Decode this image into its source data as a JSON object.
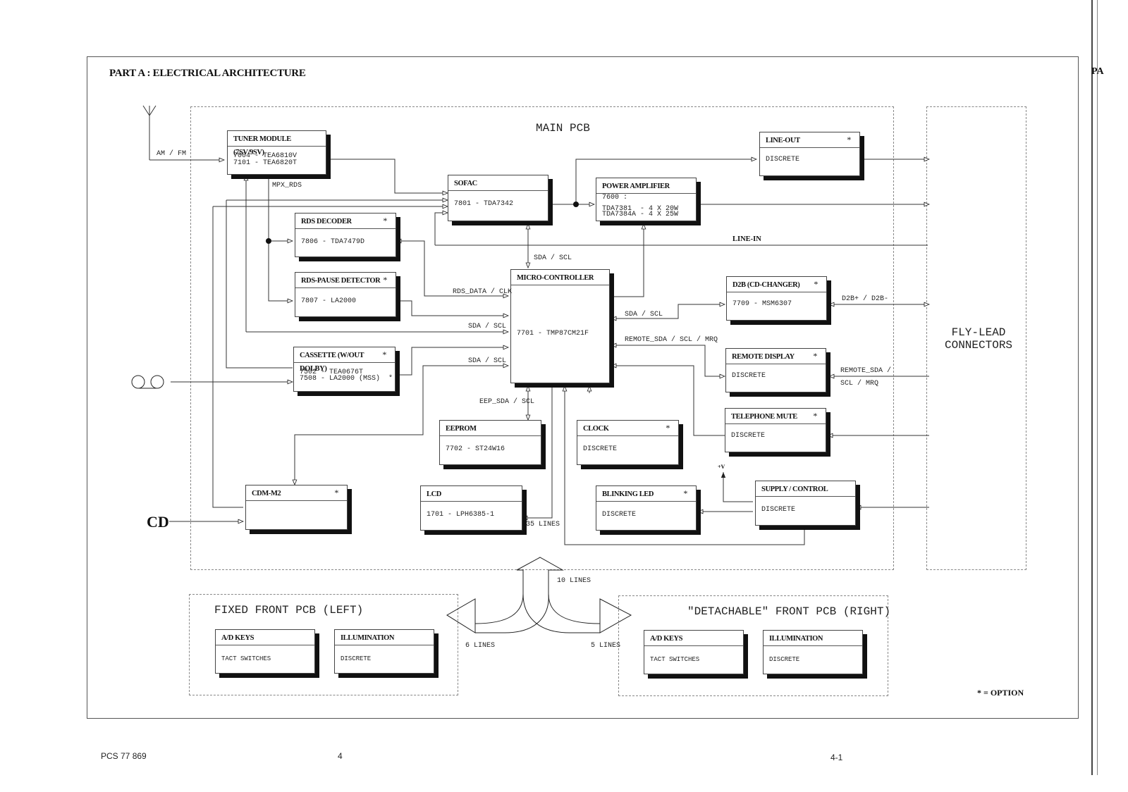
{
  "page": {
    "title": "PART A : ELECTRICAL ARCHITECTURE",
    "edge_label": "PA",
    "option_note": "* = OPTION",
    "footer": {
      "doc_id": "PCS 77 869",
      "page_num": "4",
      "section": "4-1"
    }
  },
  "regions": {
    "main_pcb": "MAIN PCB",
    "fly_lead": "FLY-LEAD\nCONNECTORS",
    "front_left": "FIXED FRONT PCB (LEFT)",
    "front_right": "\"DETACHABLE\" FRONT PCB (RIGHT)"
  },
  "blocks": {
    "tuner": {
      "title": "TUNER MODULE (7SV/9SV)",
      "body": "7004 - TEA6810V\n7101 - TEA6820T",
      "optional": false
    },
    "sofac": {
      "title": "SOFAC",
      "body": "7801 - TDA7342",
      "optional": false
    },
    "power_amp": {
      "title": "POWER AMPLIFIER",
      "body": "7600 :\n\nTDA7381  - 4 X 20W\nTDA7384A - 4 X 25W",
      "optional": false
    },
    "line_out": {
      "title": "LINE-OUT",
      "body": "DISCRETE",
      "optional": true
    },
    "rds_decoder": {
      "title": "RDS DECODER",
      "body": "7806 - TDA7479D",
      "optional": true
    },
    "rds_pause": {
      "title": "RDS-PAUSE DETECTOR",
      "body": "7807 - LA2000",
      "optional": true
    },
    "micro": {
      "title": "MICRO-CONTROLLER",
      "body": "7701 - TMP87CM21F",
      "optional": false
    },
    "d2b": {
      "title": "D2B (CD-CHANGER)",
      "body": "7709 - MSM6307",
      "optional": true
    },
    "cassette": {
      "title": "CASSETTE (W/OUT DOLBY)",
      "body": "7502 - TEA0676T\n7508 - LA2000 (MSS)  *",
      "optional": true
    },
    "remote_display": {
      "title": "REMOTE DISPLAY",
      "body": "DISCRETE",
      "optional": true
    },
    "eeprom": {
      "title": "EEPROM",
      "body": "7702 - ST24W16",
      "optional": false
    },
    "clock": {
      "title": "CLOCK",
      "body": "DISCRETE",
      "optional": true
    },
    "tel_mute": {
      "title": "TELEPHONE MUTE",
      "body": "DISCRETE",
      "optional": true
    },
    "cdm": {
      "title": "CDM-M2",
      "body": "",
      "optional": true
    },
    "lcd": {
      "title": "LCD",
      "body": "1701 - LPH6385-1",
      "optional": false
    },
    "blink_led": {
      "title": "BLINKING LED",
      "body": "DISCRETE",
      "optional": true
    },
    "supply": {
      "title": "SUPPLY / CONTROL",
      "body": "DISCRETE",
      "optional": false
    },
    "fl_keys": {
      "title": "A/D KEYS",
      "body": "TACT SWITCHES",
      "optional": false
    },
    "fl_illum": {
      "title": "ILLUMINATION",
      "body": "DISCRETE",
      "optional": false
    },
    "fr_keys": {
      "title": "A/D KEYS",
      "body": "TACT SWITCHES",
      "optional": false
    },
    "fr_illum": {
      "title": "ILLUMINATION",
      "body": "DISCRETE",
      "optional": false
    }
  },
  "signals": {
    "am_fm": "AM / FM",
    "mpx_rds": "MPX_RDS",
    "sda_scl_top": "SDA / SCL",
    "line_in": "LINE-IN",
    "rds_data": "RDS_DATA / CLK",
    "sda_scl_1": "SDA / SCL",
    "sda_scl_2": "SDA / SCL",
    "sda_scl_right": "SDA / SCL",
    "remote_bus": "REMOTE_SDA / SCL / MRQ",
    "d2b_bus": "D2B+ / D2B-",
    "remote_ext_1": "REMOTE_SDA /",
    "remote_ext_2": "SCL / MRQ",
    "eep_bus": "EEP_SDA / SCL",
    "lcd_lines": "35 LINES",
    "plus_v": "+V",
    "lines_10": "10 LINES",
    "lines_6": "6 LINES",
    "lines_5": "5 LINES",
    "cd_input": "CD"
  }
}
